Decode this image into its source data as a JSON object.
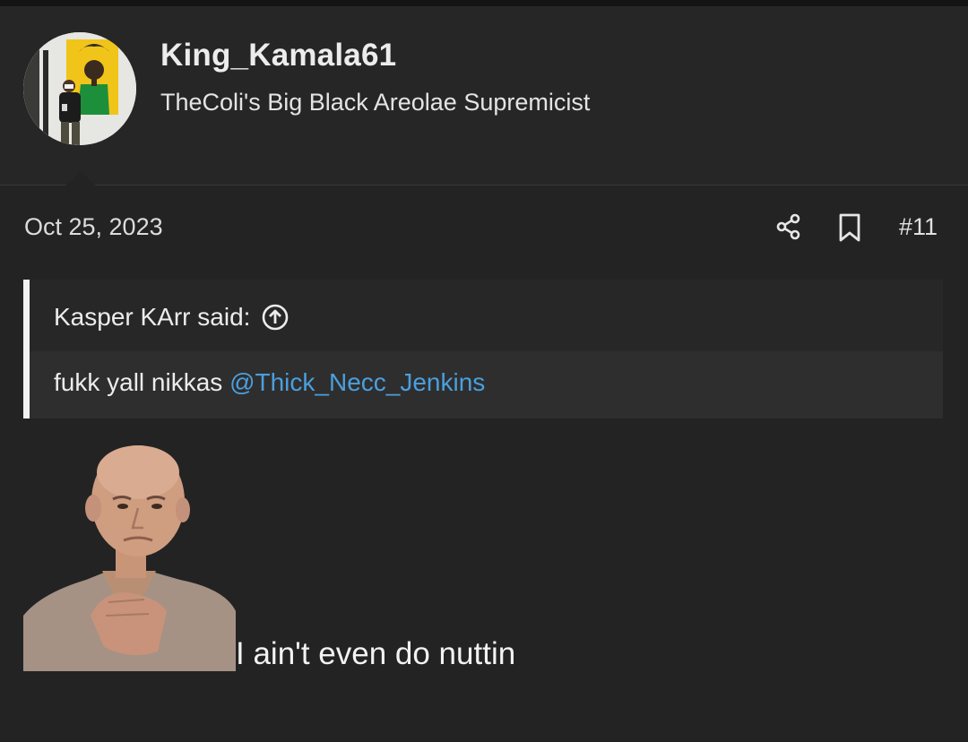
{
  "user": {
    "name": "King_Kamala61",
    "title": "TheColi's Big Black Areolae Supremicist"
  },
  "post": {
    "date": "Oct 25, 2023",
    "number": "#11",
    "body_text": "I ain't even do nuttin"
  },
  "quote": {
    "attribution": "Kasper KArr said:",
    "text": "fukk yall nikkas",
    "mention": "@Thick_Necc_Jenkins"
  },
  "colors": {
    "background": "#232323",
    "mention_link": "#4b9fdd",
    "quote_bar": "#f2f2f2"
  },
  "icons": {
    "share": "share-icon",
    "bookmark": "bookmark-icon",
    "expand_quote": "arrow-up-circle-icon"
  }
}
